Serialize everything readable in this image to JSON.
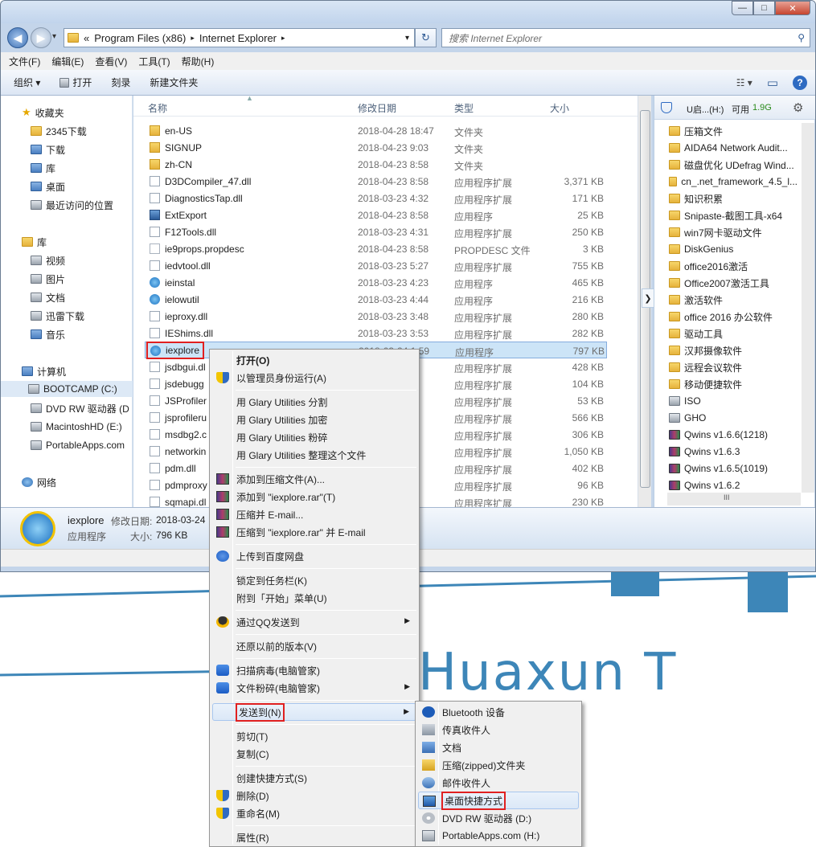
{
  "window": {
    "controls": {
      "minimize": "—",
      "maximize": "□",
      "close": "✕"
    },
    "nav": {
      "back": "◀",
      "forward": "▶",
      "dropdown": "▾"
    },
    "address": {
      "prefix": "«",
      "segments": [
        "Program Files (x86)",
        "Internet Explorer"
      ],
      "sep": "▸",
      "dropdown": "▾"
    },
    "refresh": "↻",
    "search": {
      "placeholder": "搜索 Internet Explorer",
      "icon": "⚲"
    }
  },
  "menubar": [
    "文件(F)",
    "编辑(E)",
    "查看(V)",
    "工具(T)",
    "帮助(H)"
  ],
  "toolbar": {
    "organize": "组织 ▾",
    "open": "打开",
    "burn": "刻录",
    "new_folder": "新建文件夹",
    "view": "☷ ▾",
    "pane": "▭",
    "help": "?"
  },
  "navpane": {
    "favorites_header": "收藏夹",
    "favorites": [
      "2345下载",
      "下载",
      "库",
      "桌面",
      "最近访问的位置"
    ],
    "libraries_header": "库",
    "libraries": [
      "视频",
      "图片",
      "文档",
      "迅雷下载",
      "音乐"
    ],
    "computer_header": "计算机",
    "drives": [
      "BOOTCAMP (C:)",
      "DVD RW 驱动器 (D",
      "MacintoshHD (E:)",
      "PortableApps.com"
    ],
    "network": "网络"
  },
  "filelist": {
    "columns": {
      "name": "名称",
      "date": "修改日期",
      "type": "类型",
      "size": "大小"
    },
    "rows": [
      {
        "name": "en-US",
        "date": "2018-04-28 18:47",
        "type": "文件夹",
        "size": "",
        "icon": "folder"
      },
      {
        "name": "SIGNUP",
        "date": "2018-04-23 9:03",
        "type": "文件夹",
        "size": "",
        "icon": "folder"
      },
      {
        "name": "zh-CN",
        "date": "2018-04-23 8:58",
        "type": "文件夹",
        "size": "",
        "icon": "folder"
      },
      {
        "name": "D3DCompiler_47.dll",
        "date": "2018-04-23 8:58",
        "type": "应用程序扩展",
        "size": "3,371 KB",
        "icon": "dll"
      },
      {
        "name": "DiagnosticsTap.dll",
        "date": "2018-03-23 4:32",
        "type": "应用程序扩展",
        "size": "171 KB",
        "icon": "dll"
      },
      {
        "name": "ExtExport",
        "date": "2018-04-23 8:58",
        "type": "应用程序",
        "size": "25 KB",
        "icon": "exe"
      },
      {
        "name": "F12Tools.dll",
        "date": "2018-03-23 4:31",
        "type": "应用程序扩展",
        "size": "250 KB",
        "icon": "dll"
      },
      {
        "name": "ie9props.propdesc",
        "date": "2018-04-23 8:58",
        "type": "PROPDESC 文件",
        "size": "3 KB",
        "icon": "file"
      },
      {
        "name": "iedvtool.dll",
        "date": "2018-03-23 5:27",
        "type": "应用程序扩展",
        "size": "755 KB",
        "icon": "dll"
      },
      {
        "name": "ieinstal",
        "date": "2018-03-23 4:23",
        "type": "应用程序",
        "size": "465 KB",
        "icon": "ie"
      },
      {
        "name": "ielowutil",
        "date": "2018-03-23 4:44",
        "type": "应用程序",
        "size": "216 KB",
        "icon": "ie"
      },
      {
        "name": "ieproxy.dll",
        "date": "2018-03-23 3:48",
        "type": "应用程序扩展",
        "size": "280 KB",
        "icon": "dll"
      },
      {
        "name": "IEShims.dll",
        "date": "2018-03-23 3:53",
        "type": "应用程序扩展",
        "size": "282 KB",
        "icon": "dll"
      },
      {
        "name": "iexplore",
        "date": "2018-03-24 1:59",
        "type": "应用程序",
        "size": "797 KB",
        "icon": "ie"
      },
      {
        "name": "jsdbgui.dl",
        "date": "58",
        "type": "应用程序扩展",
        "size": "428 KB",
        "icon": "dll"
      },
      {
        "name": "jsdebugg",
        "date": "58",
        "type": "应用程序扩展",
        "size": "104 KB",
        "icon": "dll"
      },
      {
        "name": "JSProfiler",
        "date": "58",
        "type": "应用程序扩展",
        "size": "53 KB",
        "icon": "dll"
      },
      {
        "name": "jsprofileru",
        "date": "26",
        "type": "应用程序扩展",
        "size": "566 KB",
        "icon": "dll"
      },
      {
        "name": "msdbg2.c",
        "date": "58",
        "type": "应用程序扩展",
        "size": "306 KB",
        "icon": "dll"
      },
      {
        "name": "networkin",
        "date": "22",
        "type": "应用程序扩展",
        "size": "1,050 KB",
        "icon": "dll"
      },
      {
        "name": "pdm.dll",
        "date": "58",
        "type": "应用程序扩展",
        "size": "402 KB",
        "icon": "dll"
      },
      {
        "name": "pdmproxy",
        "date": "58",
        "type": "应用程序扩展",
        "size": "96 KB",
        "icon": "dll"
      },
      {
        "name": "sqmapi.dl",
        "date": "59",
        "type": "应用程序扩展",
        "size": "230 KB",
        "icon": "dll"
      }
    ]
  },
  "sidepanel": {
    "drive_label": "U启...(H:)",
    "free_label": "可用",
    "free_value": "1.9G",
    "gear": "⚙",
    "toggle": "❯",
    "hscroll": "III",
    "items": [
      {
        "name": "压箱文件",
        "icon": "folder"
      },
      {
        "name": "AIDA64 Network Audit...",
        "icon": "folder"
      },
      {
        "name": "磁盘优化 UDefrag  Wind...",
        "icon": "folder"
      },
      {
        "name": "cn_.net_framework_4.5_l...",
        "icon": "folder"
      },
      {
        "name": "知识积累",
        "icon": "folder"
      },
      {
        "name": "Snipaste-截图工具-x64",
        "icon": "folder"
      },
      {
        "name": "win7网卡驱动文件",
        "icon": "folder"
      },
      {
        "name": "DiskGenius",
        "icon": "folder"
      },
      {
        "name": "office2016激活",
        "icon": "folder"
      },
      {
        "name": "Office2007激活工具",
        "icon": "folder"
      },
      {
        "name": "激活软件",
        "icon": "folder"
      },
      {
        "name": "office 2016 办公软件",
        "icon": "folder"
      },
      {
        "name": "驱动工具",
        "icon": "folder"
      },
      {
        "name": "汉邦摄像软件",
        "icon": "folder"
      },
      {
        "name": "远程会议软件",
        "icon": "folder"
      },
      {
        "name": "移动便捷软件",
        "icon": "folder"
      },
      {
        "name": "ISO",
        "icon": "drive"
      },
      {
        "name": "GHO",
        "icon": "drive"
      },
      {
        "name": "Qwins v1.6.6(1218)",
        "icon": "rar"
      },
      {
        "name": "Qwins v1.6.3",
        "icon": "rar"
      },
      {
        "name": "Qwins v1.6.5(1019)",
        "icon": "rar"
      },
      {
        "name": "Qwins v1.6.2",
        "icon": "rar"
      }
    ]
  },
  "details": {
    "name": "iexplore",
    "date_label": "修改日期:",
    "date_value": "2018-03-24",
    "type": "应用程序",
    "size_label": "大小:",
    "size_value": "796 KB"
  },
  "context_menu": [
    {
      "label": "打开(O)",
      "bold": true,
      "icon": ""
    },
    {
      "label": "以管理员身份运行(A)",
      "icon": "shield"
    },
    {
      "sep": true
    },
    {
      "label": "用 Glary Utilities 分割",
      "icon": ""
    },
    {
      "label": "用 Glary Utilities 加密",
      "icon": ""
    },
    {
      "label": "用 Glary Utilities 粉碎",
      "icon": ""
    },
    {
      "label": "用 Glary Utilities 整理这个文件",
      "icon": ""
    },
    {
      "sep": true
    },
    {
      "label": "添加到压缩文件(A)...",
      "icon": "rar"
    },
    {
      "label": "添加到 \"iexplore.rar\"(T)",
      "icon": "rar"
    },
    {
      "label": "压缩并 E-mail...",
      "icon": "rar"
    },
    {
      "label": "压缩到 \"iexplore.rar\" 并 E-mail",
      "icon": "rar"
    },
    {
      "sep": true
    },
    {
      "label": "上传到百度网盘",
      "icon": "baidu"
    },
    {
      "sep": true
    },
    {
      "label": "锁定到任务栏(K)",
      "icon": ""
    },
    {
      "label": "附到「开始」菜单(U)",
      "icon": ""
    },
    {
      "sep": true
    },
    {
      "label": "通过QQ发送到",
      "icon": "qq",
      "sub": true
    },
    {
      "sep": true
    },
    {
      "label": "还原以前的版本(V)",
      "icon": ""
    },
    {
      "sep": true
    },
    {
      "label": "扫描病毒(电脑管家)",
      "icon": "guard"
    },
    {
      "label": "文件粉碎(电脑管家)",
      "icon": "guard",
      "sub": true
    },
    {
      "sep": true
    },
    {
      "label": "发送到(N)",
      "icon": "",
      "sub": true,
      "highlight": true
    },
    {
      "sep": true
    },
    {
      "label": "剪切(T)",
      "icon": ""
    },
    {
      "label": "复制(C)",
      "icon": ""
    },
    {
      "sep": true
    },
    {
      "label": "创建快捷方式(S)",
      "icon": ""
    },
    {
      "label": "删除(D)",
      "icon": "shield"
    },
    {
      "label": "重命名(M)",
      "icon": "shield"
    },
    {
      "sep": true
    },
    {
      "label": "属性(R)",
      "icon": ""
    }
  ],
  "sendto_menu": [
    {
      "label": "Bluetooth 设备",
      "icon": "bt"
    },
    {
      "label": "传真收件人",
      "icon": "fax"
    },
    {
      "label": "文档",
      "icon": "doc"
    },
    {
      "label": "压缩(zipped)文件夹",
      "icon": "zip"
    },
    {
      "label": "邮件收件人",
      "icon": "mail"
    },
    {
      "label": "桌面快捷方式",
      "icon": "desk",
      "highlight": true
    },
    {
      "label": "DVD RW 驱动器 (D:)",
      "icon": "dvd"
    },
    {
      "label": "PortableApps.com (H:)",
      "icon": "pa"
    }
  ],
  "background": {
    "text": "Huaxun T"
  },
  "submenu_arrow": "▶"
}
